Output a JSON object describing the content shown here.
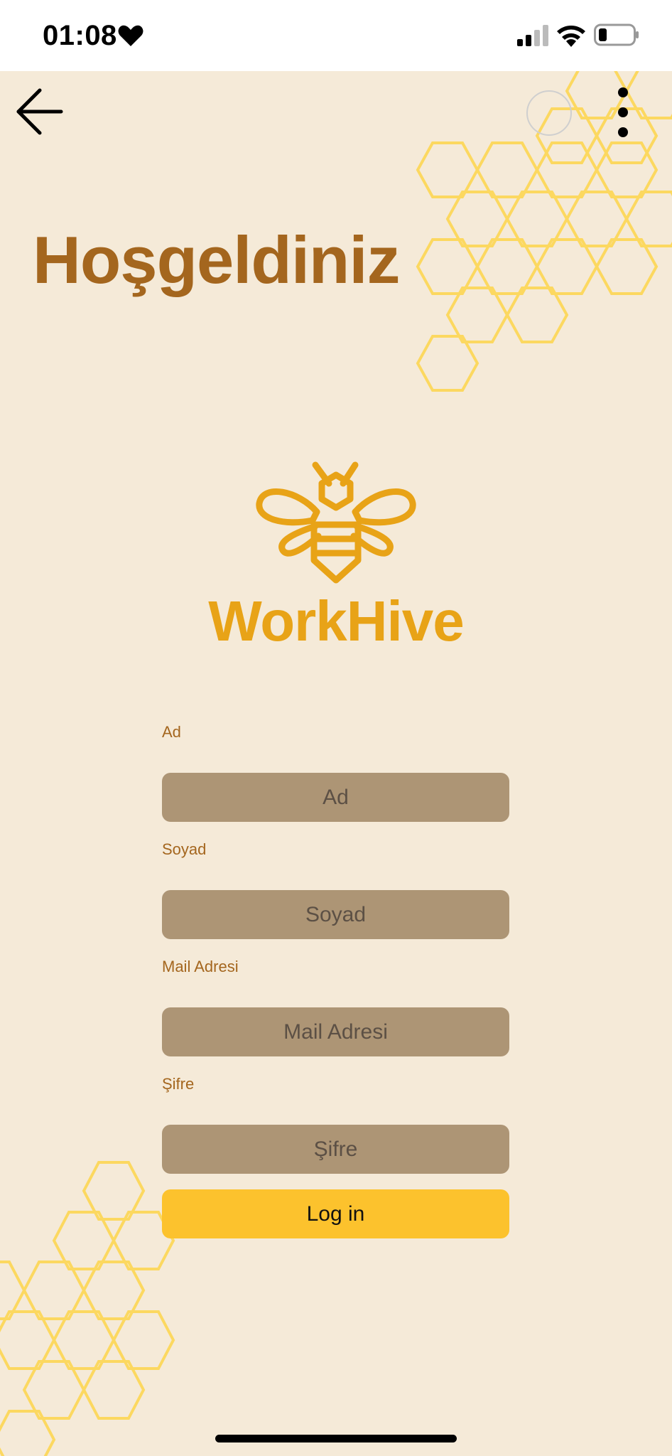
{
  "status_bar": {
    "time": "01:08",
    "icons": [
      "heart-icon",
      "cellular-signal-icon",
      "wifi-icon",
      "battery-icon"
    ]
  },
  "nav": {
    "back_icon": "arrow-left-icon",
    "menu_icon": "vertical-dots-icon"
  },
  "header": {
    "title": "Hoşgeldiniz"
  },
  "logo": {
    "icon": "bee-icon",
    "brand": "WorkHive"
  },
  "form": {
    "fields": [
      {
        "label": "Ad",
        "placeholder": "Ad"
      },
      {
        "label": "Soyad",
        "placeholder": "Soyad"
      },
      {
        "label": "Mail Adresi",
        "placeholder": "Mail Adresi"
      },
      {
        "label": "Şifre",
        "placeholder": "Şifre"
      }
    ],
    "submit_label": "Log in"
  },
  "colors": {
    "background": "#f5ead8",
    "title": "#a4661e",
    "brand": "#e8a317",
    "input_bg": "#ad9575",
    "button_bg": "#fcc22d",
    "honeycomb": "#fcd860"
  }
}
